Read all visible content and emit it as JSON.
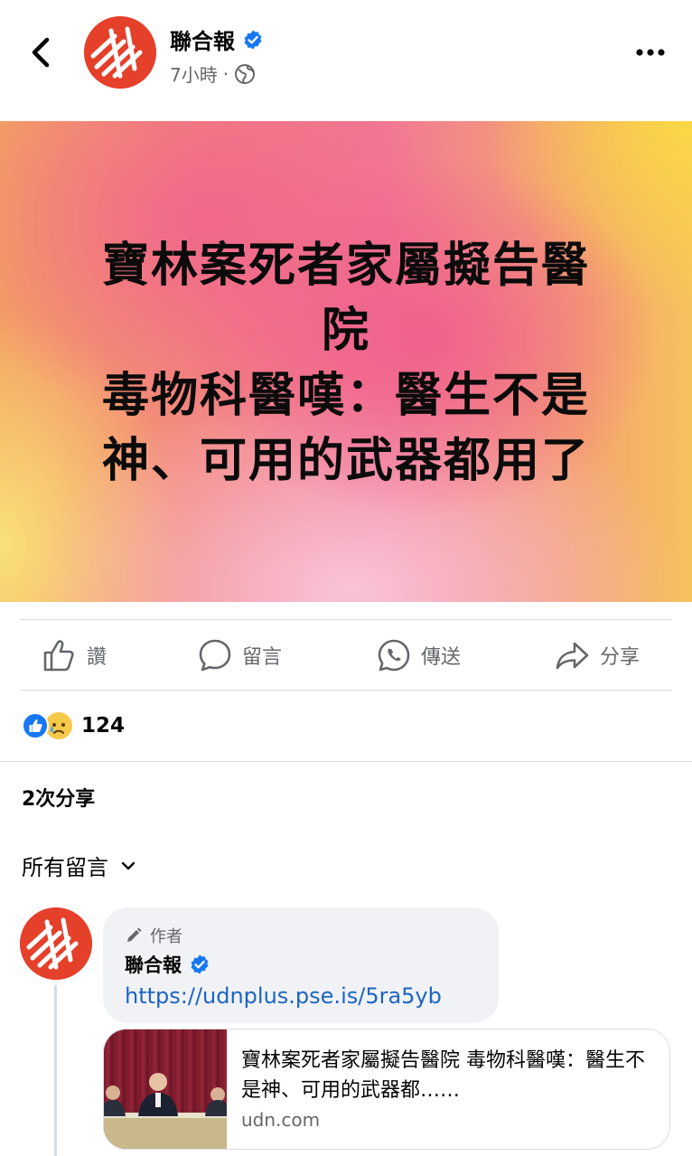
{
  "post": {
    "page_name": "聯合報",
    "time": "7小時",
    "separator": "·",
    "background_text_lines": [
      "寶林案死者家屬擬告醫",
      "院",
      "毒物科醫嘆：醫生不是",
      "神、可用的武器都用了"
    ]
  },
  "actions": {
    "like": "讚",
    "comment": "留言",
    "send": "傳送",
    "share": "分享"
  },
  "reactions": {
    "count": "124"
  },
  "shares_text": "2次分享",
  "comments_sort": "所有留言",
  "comment": {
    "author_label": "作者",
    "name": "聯合報",
    "link": "https://udnplus.pse.is/5ra5yb"
  },
  "link_preview": {
    "title": "寶林案死者家屬擬告醫院 毒物科醫嘆：醫生不是神、可用的武器都……",
    "domain": "udn.com"
  },
  "colors": {
    "brand_red": "#e4402a",
    "facebook_blue": "#1877f2",
    "link_blue": "#1d64c2",
    "secondary_text": "#65676b"
  }
}
